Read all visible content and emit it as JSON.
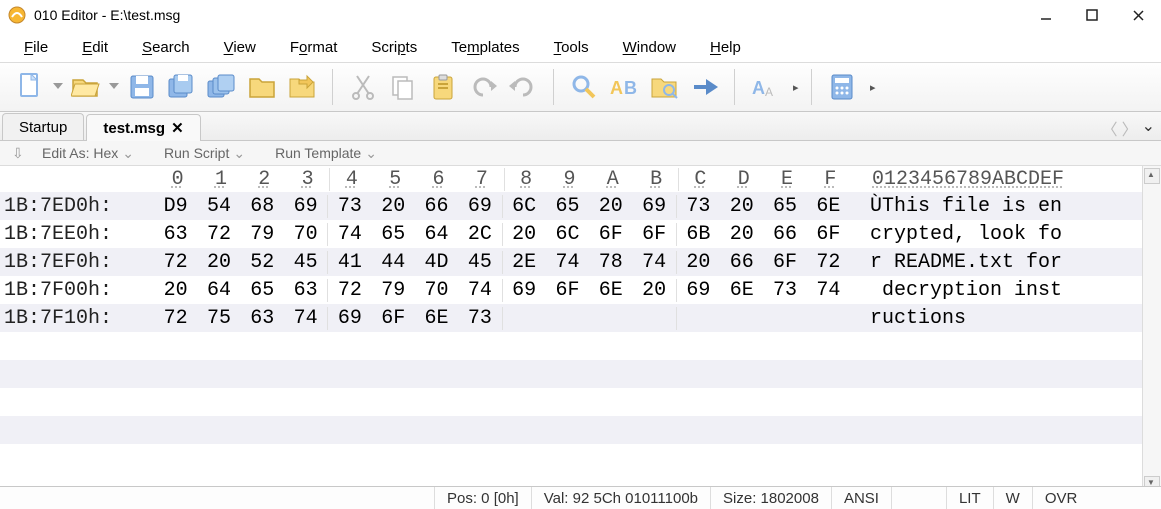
{
  "title": "010 Editor - E:\\test.msg",
  "menu": [
    "File",
    "Edit",
    "Search",
    "View",
    "Format",
    "Scripts",
    "Templates",
    "Tools",
    "Window",
    "Help"
  ],
  "tabs": {
    "inactive": "Startup",
    "active": "test.msg"
  },
  "subtoolbar": {
    "edit_as": "Edit As: Hex",
    "run_script": "Run Script",
    "run_template": "Run Template"
  },
  "hex": {
    "cols": [
      "0",
      "1",
      "2",
      "3",
      "4",
      "5",
      "6",
      "7",
      "8",
      "9",
      "A",
      "B",
      "C",
      "D",
      "E",
      "F"
    ],
    "txtcols": "0123456789ABCDEF",
    "rows": [
      {
        "addr": "1B:7ED0h:",
        "b": [
          "D9",
          "54",
          "68",
          "69",
          "73",
          "20",
          "66",
          "69",
          "6C",
          "65",
          "20",
          "69",
          "73",
          "20",
          "65",
          "6E"
        ],
        "t": "ÙThis file is en"
      },
      {
        "addr": "1B:7EE0h:",
        "b": [
          "63",
          "72",
          "79",
          "70",
          "74",
          "65",
          "64",
          "2C",
          "20",
          "6C",
          "6F",
          "6F",
          "6B",
          "20",
          "66",
          "6F"
        ],
        "t": "crypted, look fo"
      },
      {
        "addr": "1B:7EF0h:",
        "b": [
          "72",
          "20",
          "52",
          "45",
          "41",
          "44",
          "4D",
          "45",
          "2E",
          "74",
          "78",
          "74",
          "20",
          "66",
          "6F",
          "72"
        ],
        "t": "r README.txt for"
      },
      {
        "addr": "1B:7F00h:",
        "b": [
          "20",
          "64",
          "65",
          "63",
          "72",
          "79",
          "70",
          "74",
          "69",
          "6F",
          "6E",
          "20",
          "69",
          "6E",
          "73",
          "74"
        ],
        "t": " decryption inst"
      },
      {
        "addr": "1B:7F10h:",
        "b": [
          "72",
          "75",
          "63",
          "74",
          "69",
          "6F",
          "6E",
          "73",
          "",
          "",
          "",
          "",
          "",
          "",
          "",
          ""
        ],
        "t": "ructions"
      }
    ]
  },
  "status": {
    "pos": "Pos: 0 [0h]",
    "val": "Val: 92 5Ch 01011100b",
    "size": "Size: 1802008",
    "enc": "ANSI",
    "lit": "LIT",
    "w": "W",
    "ovr": "OVR"
  },
  "icons": {
    "app": "app-icon"
  }
}
